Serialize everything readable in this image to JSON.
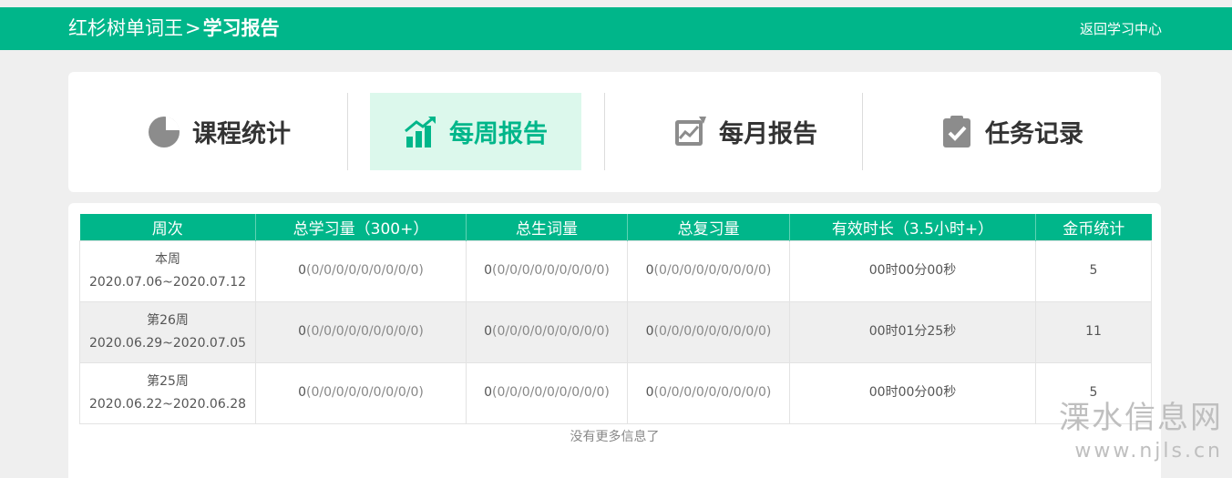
{
  "header": {
    "site": "红杉树单词王",
    "separator": ">",
    "current": "学习报告",
    "back_link": "返回学习中心"
  },
  "tabs": [
    {
      "label": "课程统计",
      "icon": "pie-chart-icon",
      "active": false
    },
    {
      "label": "每周报告",
      "icon": "bar-chart-trend-icon",
      "active": true
    },
    {
      "label": "每月报告",
      "icon": "line-chart-board-icon",
      "active": false
    },
    {
      "label": "任务记录",
      "icon": "clipboard-check-icon",
      "active": false
    }
  ],
  "table": {
    "headers": [
      "周次",
      "总学习量（300+）",
      "总生词量",
      "总复习量",
      "有效时长（3.5小时+）",
      "金币统计"
    ],
    "rows": [
      {
        "week": "本周",
        "range": "2020.07.06~2020.07.12",
        "study_total": "0",
        "study_detail": "(0/0/0/0/0/0/0/0/0)",
        "new_total": "0",
        "new_detail": "(0/0/0/0/0/0/0/0/0)",
        "review_total": "0",
        "review_detail": "(0/0/0/0/0/0/0/0/0)",
        "time": "00时00分00秒",
        "coins": "5"
      },
      {
        "week": "第26周",
        "range": "2020.06.29~2020.07.05",
        "study_total": "0",
        "study_detail": "(0/0/0/0/0/0/0/0/0)",
        "new_total": "0",
        "new_detail": "(0/0/0/0/0/0/0/0/0)",
        "review_total": "0",
        "review_detail": "(0/0/0/0/0/0/0/0/0)",
        "time": "00时01分25秒",
        "coins": "11"
      },
      {
        "week": "第25周",
        "range": "2020.06.22~2020.06.28",
        "study_total": "0",
        "study_detail": "(0/0/0/0/0/0/0/0/0)",
        "new_total": "0",
        "new_detail": "(0/0/0/0/0/0/0/0/0)",
        "review_total": "0",
        "review_detail": "(0/0/0/0/0/0/0/0/0)",
        "time": "00时00分00秒",
        "coins": "5"
      }
    ],
    "footer": "没有更多信息了"
  },
  "watermark": {
    "name": "溧水信息网",
    "url": "www.njls.cn"
  },
  "colors": {
    "brand": "#00b68a",
    "active_tab_bg": "#dcf8ec",
    "icon_gray": "#8c8c8c"
  }
}
